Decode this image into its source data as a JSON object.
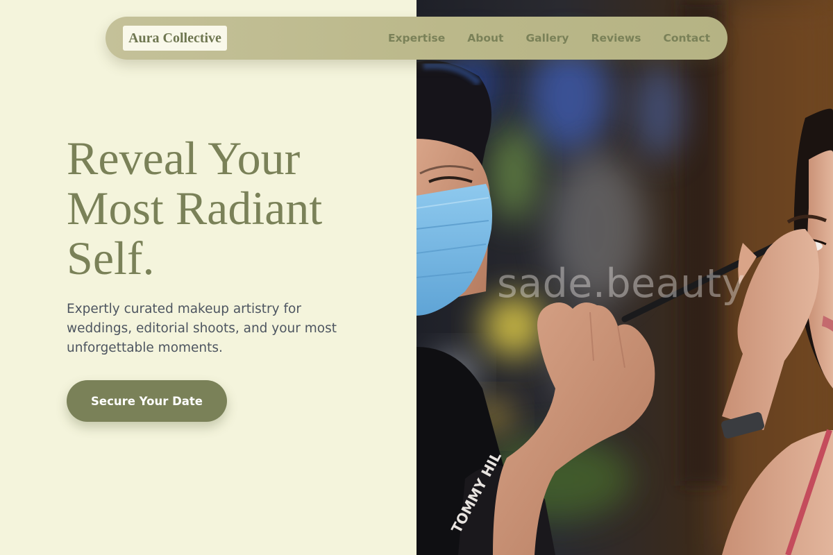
{
  "brand": {
    "logo_text": "Aura Collective"
  },
  "nav": {
    "links": [
      "Expertise",
      "About",
      "Gallery",
      "Reviews",
      "Contact"
    ]
  },
  "hero": {
    "title_lines": [
      "Reveal Your",
      "Most Radiant",
      "Self."
    ],
    "subtitle": "Expertly curated makeup artistry for weddings, editorial shoots, and your most unforgettable moments.",
    "cta_label": "Secure Your Date"
  },
  "photo": {
    "watermark": "sade.beauty",
    "sleeve_text": "TOMMY HIL"
  },
  "colors": {
    "background": "#f4f4dc",
    "accent": "#7a8158",
    "navbar": "#bbb88a",
    "text_muted": "#4d5560"
  }
}
